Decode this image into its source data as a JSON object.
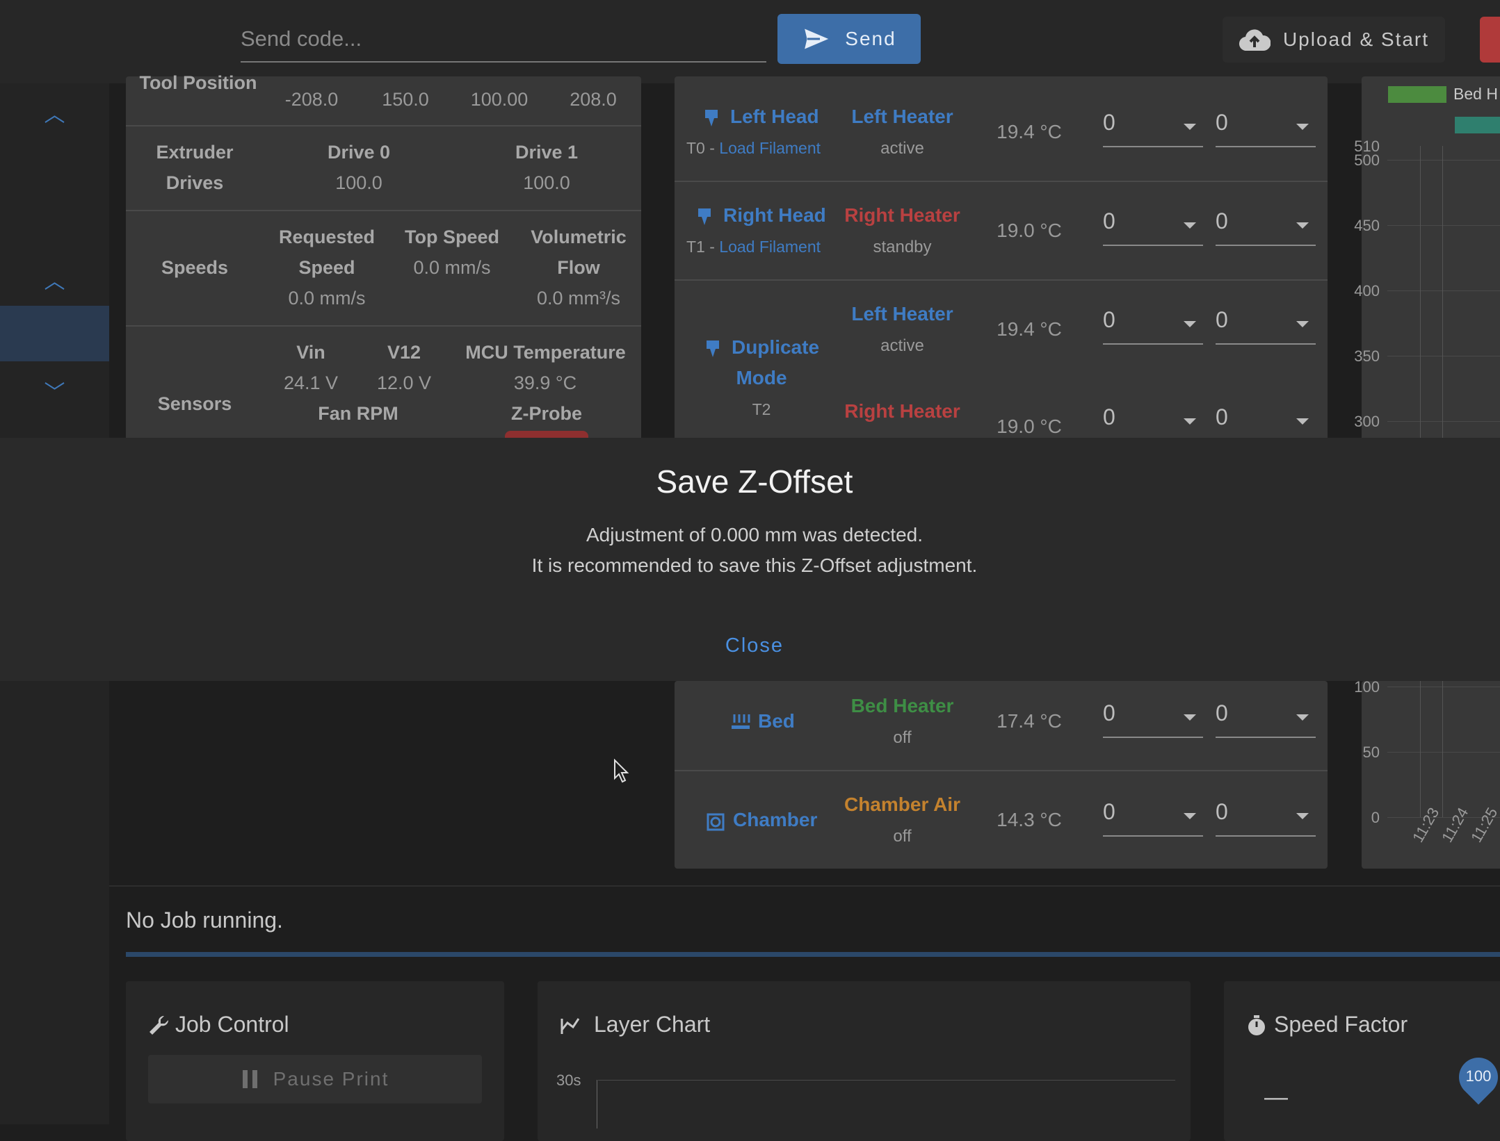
{
  "topbar": {
    "send_placeholder": "Send code...",
    "send_label": "Send",
    "upload_label": "Upload & Start"
  },
  "tool_position": {
    "label": "Tool Position",
    "values": [
      "-208.0",
      "150.0",
      "100.00",
      "208.0"
    ]
  },
  "extruder": {
    "label_line1": "Extruder",
    "label_line2": "Drives",
    "drives": [
      {
        "name": "Drive 0",
        "value": "100.0"
      },
      {
        "name": "Drive 1",
        "value": "100.0"
      }
    ]
  },
  "speeds": {
    "label": "Speeds",
    "requested_line1": "Requested",
    "requested_line2": "Speed",
    "requested_value": "0.0 mm/s",
    "top_label": "Top Speed",
    "top_value": "0.0 mm/s",
    "volumetric_line1": "Volumetric",
    "volumetric_line2": "Flow",
    "volumetric_value": "0.0 mm³/s"
  },
  "sensors": {
    "label": "Sensors",
    "vin_label": "Vin",
    "vin_value": "24.1 V",
    "v12_label": "V12",
    "v12_value": "12.0 V",
    "mcu_label": "MCU Temperature",
    "mcu_value": "39.9 °C",
    "fan_label": "Fan RPM",
    "zprobe_label": "Z-Probe"
  },
  "tools": {
    "left_head": {
      "name": "Left Head",
      "sub_prefix": "T0 - ",
      "sub_link": "Load Filament",
      "heater": "Left Heater",
      "state": "active",
      "temp": "19.4 °C",
      "active": "0",
      "standby": "0"
    },
    "right_head": {
      "name": "Right Head",
      "sub_prefix": "T1 - ",
      "sub_link": "Load Filament",
      "heater": "Right Heater",
      "state": "standby",
      "temp": "19.0 °C",
      "active": "0",
      "standby": "0"
    },
    "duplicate": {
      "name_line1": "Duplicate",
      "name_line2": "Mode",
      "sub": "T2",
      "heater1": "Left Heater",
      "state1": "active",
      "temp1": "19.4 °C",
      "heater2": "Right Heater",
      "temp2": "19.0 °C",
      "active1": "0",
      "standby1": "0",
      "active2": "0",
      "standby2": "0"
    },
    "bed": {
      "name": "Bed",
      "heater": "Bed Heater",
      "state": "off",
      "temp": "17.4 °C",
      "active": "0",
      "standby": "0"
    },
    "chamber": {
      "name": "Chamber",
      "heater": "Chamber Air",
      "state": "off",
      "temp": "14.3 °C",
      "active": "0",
      "standby": "0"
    }
  },
  "temp_chart": {
    "legend": "Bed H",
    "y_ticks_top": [
      "510",
      "500",
      "450",
      "400",
      "350",
      "300"
    ],
    "y_ticks_bottom": [
      "100",
      "50",
      "0"
    ],
    "x_ticks": [
      "11:23",
      "11:24",
      "11:25"
    ]
  },
  "modal": {
    "title": "Save Z-Offset",
    "line1": "Adjustment of 0.000 mm was detected.",
    "line2": "It is recommended to save this Z-Offset adjustment.",
    "close_label": "Close"
  },
  "job": {
    "status": "No Job running.",
    "job_control_title": "Job Control",
    "pause_label": "Pause Print",
    "layer_chart_title": "Layer Chart",
    "layer_chart_tick": "30s",
    "speed_factor_title": "Speed Factor",
    "speed_factor_value": "100",
    "speed_factor_minus": "—"
  },
  "colors": {
    "accent": "#3d6ea8",
    "heater_red": "#b94141",
    "bed_green": "#3e8e45",
    "chamber_orange": "#c4822e"
  }
}
